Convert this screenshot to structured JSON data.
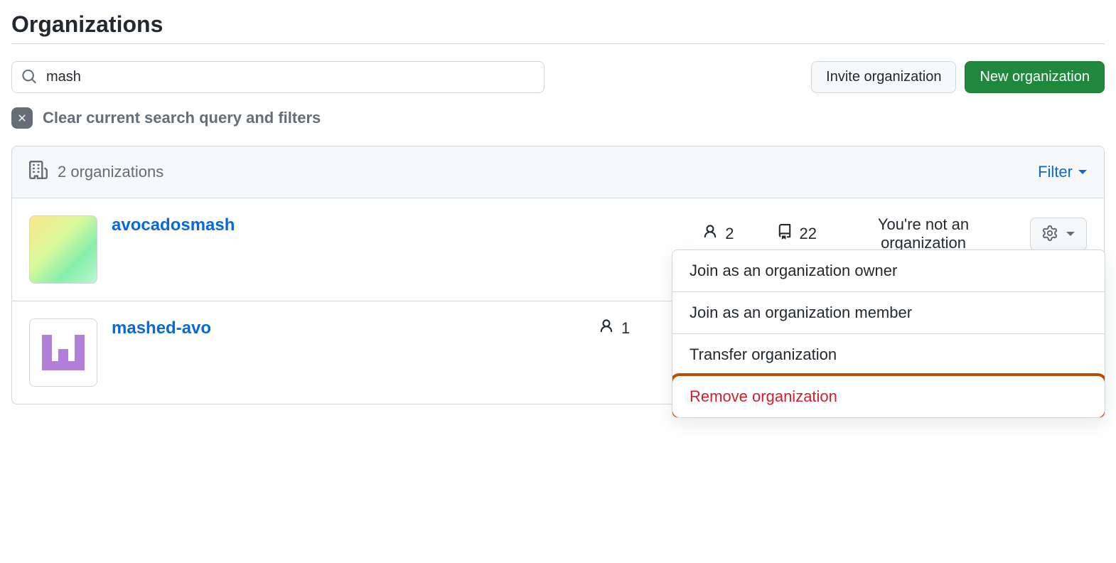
{
  "page": {
    "title": "Organizations"
  },
  "search": {
    "value": "mash"
  },
  "actions": {
    "invite": "Invite organization",
    "new": "New organization"
  },
  "clear": {
    "text": "Clear current search query and filters"
  },
  "list": {
    "count_label": "2 organizations",
    "filter_label": "Filter"
  },
  "orgs": [
    {
      "name": "avocadosmash",
      "members": "2",
      "repos": "22",
      "role": "You're not an organization"
    },
    {
      "name": "mashed-avo",
      "members": "1"
    }
  ],
  "menu": {
    "join_owner": "Join as an organization owner",
    "join_member": "Join as an organization member",
    "transfer": "Transfer organization",
    "remove": "Remove organization"
  }
}
